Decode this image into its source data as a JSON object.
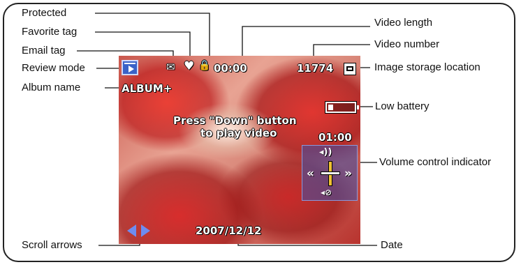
{
  "callouts": {
    "protected": "Protected",
    "favorite_tag": "Favorite tag",
    "email_tag": "Email tag",
    "review_mode": "Review mode",
    "album_name": "Album name",
    "video_length": "Video length",
    "video_number": "Video number",
    "image_storage_location": "Image storage location",
    "low_battery": "Low battery",
    "volume_control_indicator": "Volume control indicator",
    "scroll_arrows": "Scroll arrows",
    "date": "Date"
  },
  "screen": {
    "video_length": "00:00",
    "video_number": "11774",
    "album_name": "ALBUM+",
    "prompt_line1": "Press \"Down\" button",
    "prompt_line2": "to play video",
    "remaining_time": "01:00",
    "date": "2007/12/12"
  },
  "icons": {
    "email": "✉",
    "favorite": "♥",
    "protected": "🔒",
    "volume_up": "◂))",
    "volume_rewind": "«",
    "volume_forward": "»",
    "volume_mute": "◂⊘"
  },
  "colors": {
    "screen_accent": "#3a62c8",
    "slider": "#f1c232",
    "scroll_arrows": "#6e8cf0"
  }
}
